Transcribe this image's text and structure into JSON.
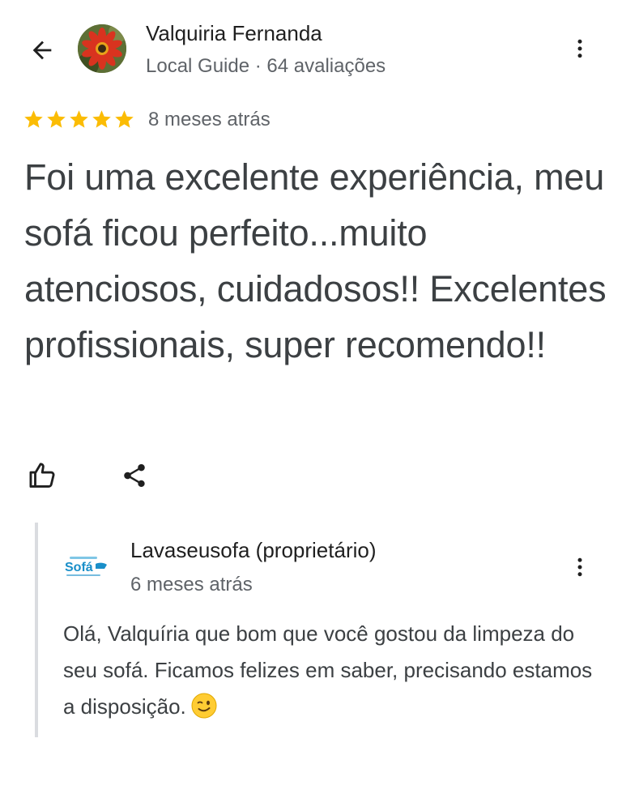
{
  "header": {
    "author_name": "Valquiria Fernanda",
    "author_meta": "Local Guide · 64 avaliações"
  },
  "review": {
    "rating_stars": 5,
    "date": "8 meses atrás",
    "text": "Foi uma excelente experiência, meu sofá ficou perfeito...muito atenciosos, cuidadosos!! Excelentes profissionais, super recomendo!!"
  },
  "owner_reply": {
    "name": "Lavaseusofa (proprietário)",
    "logo_text": "Sofá",
    "date": "6 meses atrás",
    "text": "Olá, Valquíria que bom que você gostou da limpeza do seu sofá. Ficamos felizes em saber, precisando estamos a disposição."
  },
  "icons": {
    "back": "arrow-back-icon",
    "more": "more-vert-icon",
    "like": "thumb-up-icon",
    "share": "share-icon",
    "star": "star-icon",
    "emoji": "winking-face-emoji"
  },
  "colors": {
    "star": "#FBBC04",
    "text_primary": "#1f1f1f",
    "text_secondary": "#5f6368",
    "reply_bar": "#dadce0",
    "logo_blue": "#1a8fc9"
  }
}
